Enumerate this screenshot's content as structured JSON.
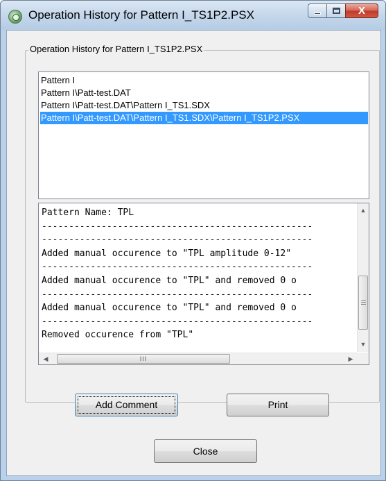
{
  "window": {
    "title": "Operation History for Pattern I_TS1P2.PSX",
    "icon": "app-globe-icon",
    "caption_buttons": {
      "minimize_glyph": "—",
      "maximize_glyph": "☐",
      "close_glyph": "X"
    }
  },
  "group": {
    "label": "Operation History for Pattern I_TS1P2.PSX"
  },
  "path_list": {
    "items": [
      {
        "label": "Pattern I"
      },
      {
        "label": "Pattern I\\Patt-test.DAT"
      },
      {
        "label": "Pattern I\\Patt-test.DAT\\Pattern I_TS1.SDX"
      },
      {
        "label": "Pattern I\\Patt-test.DAT\\Pattern I_TS1.SDX\\Pattern I_TS1P2.PSX"
      }
    ],
    "selected_index": 3
  },
  "log": {
    "lines": [
      "Pattern Name: TPL",
      "--------------------------------------------------",
      "--------------------------------------------------",
      "Added manual occurence to \"TPL amplitude 0-12\"",
      "--------------------------------------------------",
      "Added manual occurence to \"TPL\" and removed 0 o",
      "--------------------------------------------------",
      "Added manual occurence to \"TPL\" and removed 0 o",
      "--------------------------------------------------",
      "Removed occurence from \"TPL\""
    ],
    "scroll": {
      "up_glyph": "▲",
      "down_glyph": "▼",
      "left_glyph": "◀",
      "right_glyph": "▶",
      "thumb_glyph": "III"
    }
  },
  "buttons": {
    "add_comment": "Add Comment",
    "print": "Print",
    "close": "Close"
  },
  "colors": {
    "selection": "#3399ff",
    "frame": "#b9d1ea",
    "close_button": "#c0392b"
  }
}
